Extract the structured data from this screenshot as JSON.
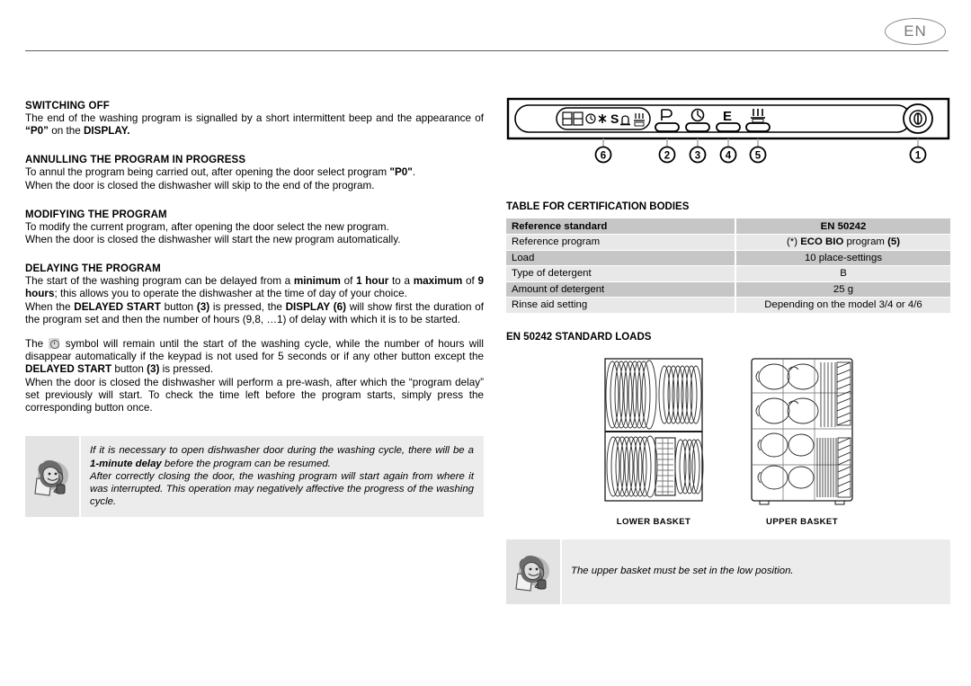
{
  "header": {
    "language_badge": "EN"
  },
  "left_column": {
    "sections": [
      {
        "id": "switching-off",
        "title": "SWITCHING OFF",
        "paragraphs": [
          "The end of the washing program is signalled by a short intermittent beep and the appearance of “P0” on the DISPLAY."
        ]
      },
      {
        "id": "annulling-program",
        "title": "ANNULLING THE PROGRAM IN PROGRESS",
        "paragraphs": [
          "To annul the program being carried out, after opening the door select program \"P0\".",
          "When the door is closed the dishwasher will skip to the end of the program."
        ]
      },
      {
        "id": "modifying-program",
        "title": "MODIFYING THE PROGRAM",
        "paragraphs": [
          "To modify the current program, after opening the door select the new program.",
          "When the door is closed the dishwasher will start the new program automatically."
        ]
      },
      {
        "id": "delaying-program",
        "title": "DELAYING THE PROGRAM",
        "paragraphs": [
          "The start of the washing program can be delayed from a minimum of 1 hour to a maximum of 9 hours; this allows you to operate the dishwasher at the time of day of your choice.",
          "When the DELAYED START button (3) is pressed, the DISPLAY (6) will show first the duration of the program set and then the number of hours (9,8, …1) of delay with which it is to be started.",
          "The [clock] symbol will remain until the start of the washing cycle, while the number of hours will disappear automatically if the keypad is not used for 5 seconds or if any other button except the DELAYED START button (3) is pressed.",
          "When the door is closed the dishwasher will perform a pre-wash, after which the “program delay” set previously will start. To check the time left before the program starts, simply press the corresponding button once."
        ]
      }
    ],
    "note": {
      "icon": "person-on-phone-icon",
      "lines": [
        "If it is necessary to open dishwasher door during the washing cycle, there will be a 1-minute delay before the program can be resumed.",
        "After correctly closing the door, the washing program will start again from where it was interrupted. This operation may negatively affective the progress of the washing cycle."
      ]
    }
  },
  "control_panel": {
    "display_icons": [
      "digit-88",
      "clock-icon",
      "asterisk-icon",
      "s-icon",
      "salt-icon",
      "rinse-aid-icon"
    ],
    "buttons": [
      {
        "symbol": "P",
        "callout": "2",
        "name": "program-button"
      },
      {
        "symbol": "clock",
        "callout": "3",
        "name": "delayed-start-button"
      },
      {
        "symbol": "E",
        "callout": "4",
        "name": "eco-button"
      },
      {
        "symbol": "heater",
        "callout": "5",
        "name": "half-load-button"
      }
    ],
    "power_callout": "1",
    "display_callout": "6",
    "power_symbol": "power-icon"
  },
  "certification": {
    "title": "TABLE FOR CERTIFICATION BODIES",
    "rows": [
      {
        "label": "Reference standard",
        "value": "EN 50242",
        "header": true
      },
      {
        "label": "Reference program",
        "value": "(*) ECO BIO program (5)",
        "header": false
      },
      {
        "label": "Load",
        "value": "10 place-settings",
        "header": false
      },
      {
        "label": "Type of detergent",
        "value": "B",
        "header": false
      },
      {
        "label": "Amount of detergent",
        "value": "25 g",
        "header": false
      },
      {
        "label": "Rinse aid setting",
        "value": "Depending on the model 3/4 or 4/6",
        "header": false
      }
    ]
  },
  "standard_loads": {
    "title": "EN 50242 STANDARD LOADS",
    "lower_basket_caption": "LOWER BASKET",
    "upper_basket_caption": "UPPER BASKET",
    "note": {
      "icon": "person-on-phone-icon",
      "text": "The upper basket must be set in the low position."
    }
  },
  "colors": {
    "table_header_bg": "#c6c6c6",
    "table_row_alt_bg": "#e8e8e8",
    "note_bg": "#ececec",
    "badge_border": "#8c8c8c",
    "rule": "#5f5f5f"
  }
}
